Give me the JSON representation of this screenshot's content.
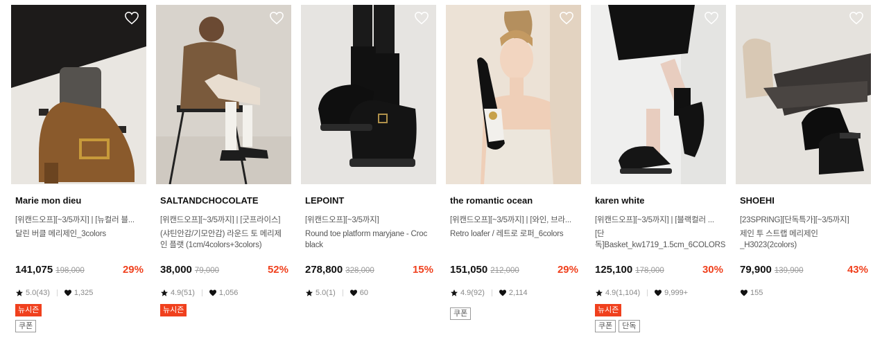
{
  "colors": {
    "discount": "#f0401d",
    "badge_new_bg": "#f0401d",
    "text_main": "#111111",
    "text_sub": "#555555",
    "text_muted": "#999999"
  },
  "icons": {
    "wishlist": "heart-outline-icon",
    "rating": "star-icon",
    "likes": "heart-filled-icon"
  },
  "products": [
    {
      "brand": "Marie mon dieu",
      "promo": "[위캔드오프][~3/5까지] | [뉴컬러 블...",
      "name": "달린 버클 메리제인_3colors",
      "price": "141,075",
      "original": "198,000",
      "discount": "29%",
      "rating": "5.0(43)",
      "likes": "1,325",
      "badge_new": "뉴시즌",
      "tags": [
        "쿠폰"
      ]
    },
    {
      "brand": "SALTANDCHOCOLATE",
      "promo": "[위캔드오프][~3/5까지] | [굿프라이스]",
      "name": "(샤틴안감/기모안감) 라운드 토 메리제인 플랫 (1cm/4colors+3colors)",
      "price": "38,000",
      "original": "79,000",
      "discount": "52%",
      "rating": "4.9(51)",
      "likes": "1,056",
      "badge_new": "뉴시즌",
      "tags": []
    },
    {
      "brand": "LEPOINT",
      "promo": "[위캔드오프][~3/5까지]",
      "name": "Round toe platform maryjane - Croc black",
      "price": "278,800",
      "original": "328,000",
      "discount": "15%",
      "rating": "5.0(1)",
      "likes": "60",
      "badge_new": "",
      "tags": []
    },
    {
      "brand": "the romantic ocean",
      "promo": "[위캔드오프][~3/5까지] | [와인, 브라...",
      "name": "Retro loafer / 레트로 로퍼_6colors",
      "price": "151,050",
      "original": "212,000",
      "discount": "29%",
      "rating": "4.9(92)",
      "likes": "2,114",
      "badge_new": "",
      "tags": [
        "쿠폰"
      ]
    },
    {
      "brand": "karen white",
      "promo": "[위캔드오프][~3/5까지] | [블랙컬러 ...",
      "name": "[단독]Basket_kw1719_1.5cm_6COLORS",
      "price": "125,100",
      "original": "178,000",
      "discount": "30%",
      "rating": "4.9(1,104)",
      "likes": "9,999+",
      "badge_new": "뉴시즌",
      "tags": [
        "쿠폰",
        "단독"
      ]
    },
    {
      "brand": "SHOEHI",
      "promo": "[23SPRING][단독특가][~3/5까지]",
      "name": "제인 투 스트랩 메리제인_H3023(2colors)",
      "price": "79,900",
      "original": "139,900",
      "discount": "43%",
      "rating": "",
      "likes": "155",
      "badge_new": "",
      "tags": []
    }
  ]
}
